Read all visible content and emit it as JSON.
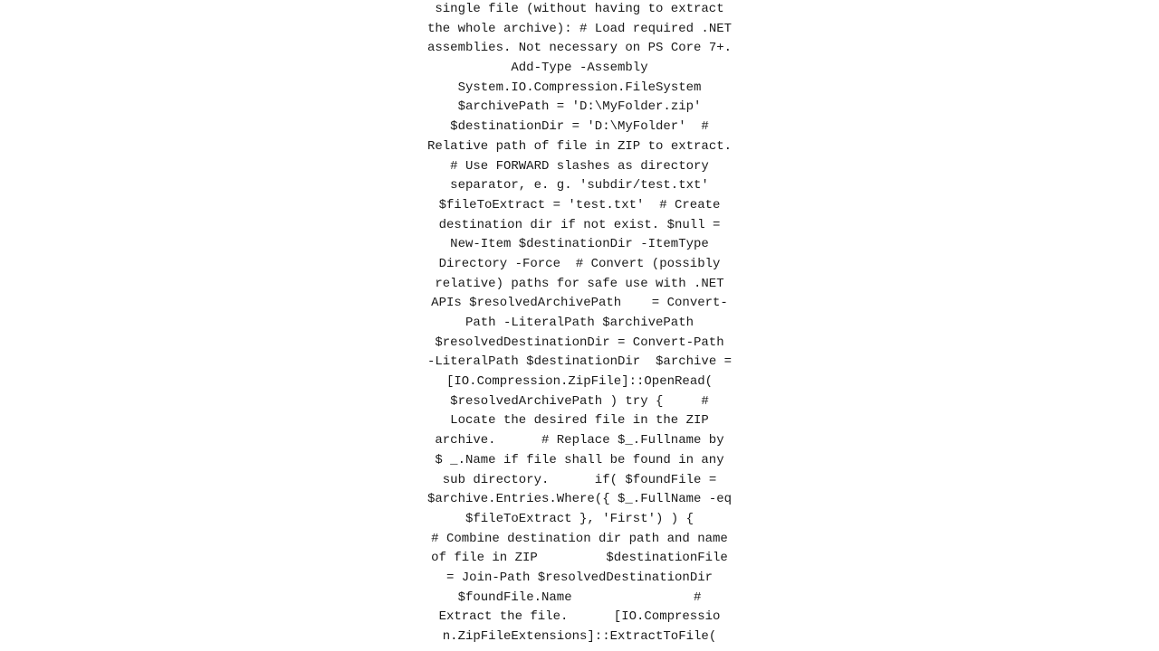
{
  "code": {
    "lines": [
      "single file (without having to extract",
      "the whole archive): # Load required .NET",
      "assemblies. Not necessary on PS Core 7+.",
      "Add-Type -Assembly",
      "System.IO.Compression.FileSystem",
      "$archivePath = 'D:\\MyFolder.zip'",
      "$destinationDir = 'D:\\MyFolder'  #",
      "Relative path of file in ZIP to extract.",
      "# Use FORWARD slashes as directory",
      "separator, e. g. 'subdir/test.txt'",
      "$fileToExtract = 'test.txt'  # Create",
      "destination dir if not exist. $null =",
      "New-Item $destinationDir -ItemType",
      "Directory -Force  # Convert (possibly",
      "relative) paths for safe use with .NET",
      "APIs $resolvedArchivePath    = Convert-",
      "Path -LiteralPath $archivePath",
      "$resolvedDestinationDir = Convert-Path",
      "-LiteralPath $destinationDir  $archive =",
      "[IO.Compression.ZipFile]::OpenRead(",
      "$resolvedArchivePath ) try {     #",
      "Locate the desired file in the ZIP",
      "archive.      # Replace $_.Fullname by",
      "$ _.Name if file shall be found in any",
      "sub directory.      if( $foundFile =",
      "$archive.Entries.Where({ $_.FullName -eq",
      "$fileToExtract }, 'First') ) {",
      "# Combine destination dir path and name",
      "of file in ZIP         $destinationFile",
      "= Join-Path $resolvedDestinationDir",
      "$foundFile.Name                #",
      "Extract the file.      [IO.Compressio",
      "n.ZipFileExtensions]::ExtractToFile("
    ]
  }
}
